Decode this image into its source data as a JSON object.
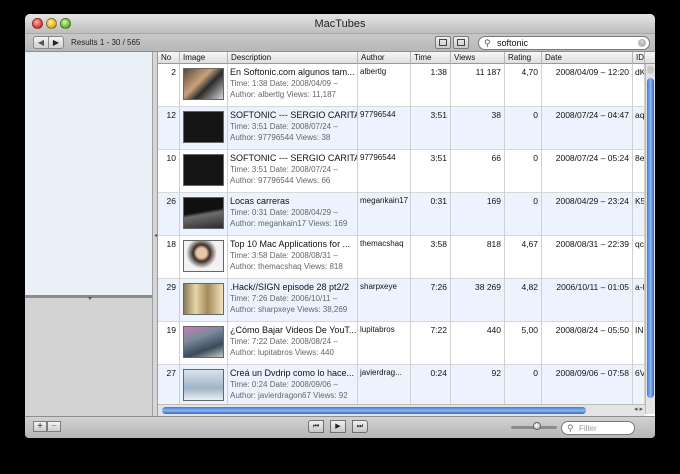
{
  "window": {
    "title": "MacTubes"
  },
  "toolbar": {
    "back_label": "◀",
    "forward_label": "▶",
    "results_label": "Results 1 - 30 / 565",
    "search_value": "softonic"
  },
  "table": {
    "columns": [
      "No",
      "Image",
      "Description",
      "Author",
      "Time",
      "Views",
      "Rating",
      "Date",
      "ID"
    ],
    "rows": [
      {
        "no": "2",
        "title": "En Softonic.com algunos tam...",
        "line1": "Time: 1:38  Date: 2008/04/09 –",
        "line2": "Author: albertlg  Views: 11,187",
        "author": "albertlg",
        "time": "1:38",
        "views": "11 187",
        "rating": "4,70",
        "date": "2008/04/09 – 12:20",
        "id": "dK"
      },
      {
        "no": "12",
        "title": "SOFTONIC --- SERGIO CARITAS",
        "line1": "Time: 3:51  Date: 2008/07/24 –",
        "line2": "Author: 97796544  Views: 38",
        "author": "97796544",
        "time": "3:51",
        "views": "38",
        "rating": "0",
        "date": "2008/07/24 – 04:47",
        "id": "aq"
      },
      {
        "no": "10",
        "title": "SOFTONIC --- SERGIO CARITAS",
        "line1": "Time: 3:51  Date: 2008/07/24 –",
        "line2": "Author: 97796544  Views: 66",
        "author": "97796544",
        "time": "3:51",
        "views": "66",
        "rating": "0",
        "date": "2008/07/24 – 05:24",
        "id": "8e"
      },
      {
        "no": "26",
        "title": "Locas carreras",
        "line1": "Time: 0:31  Date: 2008/04/29 –",
        "line2": "Author: megankain17  Views: 169",
        "author": "megankain17",
        "time": "0:31",
        "views": "169",
        "rating": "0",
        "date": "2008/04/29 – 23:24",
        "id": "K5"
      },
      {
        "no": "18",
        "title": "Top 10 Mac Applications for ...",
        "line1": "Time: 3:58  Date: 2008/08/31 –",
        "line2": "Author: themacshaq  Views: 818",
        "author": "themacshaq",
        "time": "3:58",
        "views": "818",
        "rating": "4,67",
        "date": "2008/08/31 – 22:39",
        "id": "qc"
      },
      {
        "no": "29",
        "title": ".Hack//SIGN episode 28 pt2/2",
        "line1": "Time: 7:26  Date: 2006/10/11 –",
        "line2": "Author: sharpxeye  Views: 38,269",
        "author": "sharpxeye",
        "time": "7:26",
        "views": "38 269",
        "rating": "4,82",
        "date": "2006/10/11 – 01:05",
        "id": "a-l"
      },
      {
        "no": "19",
        "title": "¿Cómo Bajar Videos De YouT...",
        "line1": "Time: 7:22  Date: 2008/08/24 –",
        "line2": "Author: lupitabros  Views: 440",
        "author": "lupitabros",
        "time": "7:22",
        "views": "440",
        "rating": "5,00",
        "date": "2008/08/24 – 05:50",
        "id": "IN"
      },
      {
        "no": "27",
        "title": "Creá un Dvdrip como lo hace...",
        "line1": "Time: 0:24  Date: 2008/09/06 –",
        "line2": "Author: javierdragon67  Views: 92",
        "author": "javierdrag...",
        "time": "0:24",
        "views": "92",
        "rating": "0",
        "date": "2008/09/06 – 07:58",
        "id": "6V"
      }
    ]
  },
  "bottom": {
    "add_label": "+",
    "remove_label": "−",
    "prev_label": "⏮",
    "play_label": "▶",
    "next_label": "⏭",
    "filter_placeholder": "Filter"
  }
}
